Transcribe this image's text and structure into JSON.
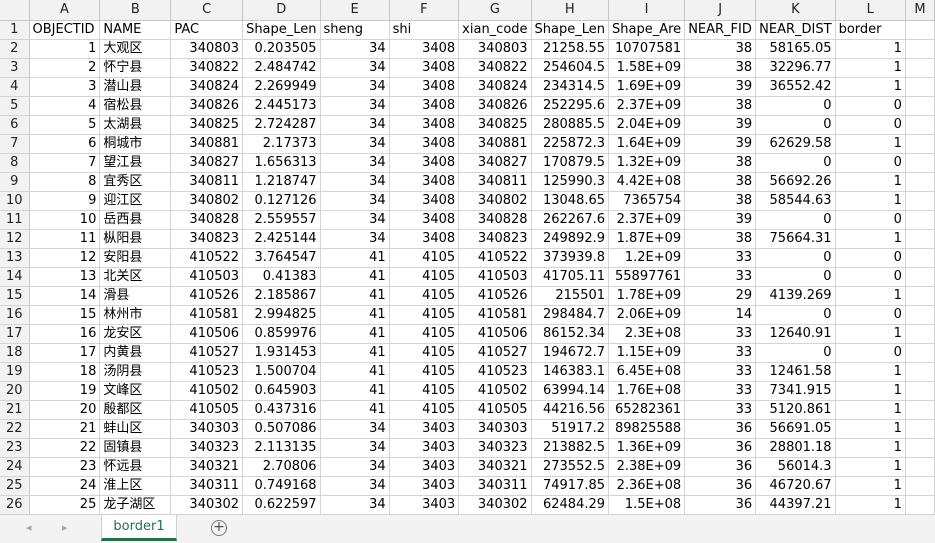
{
  "sheet": {
    "column_letters": [
      "A",
      "B",
      "C",
      "D",
      "E",
      "F",
      "G",
      "H",
      "I",
      "J",
      "K",
      "L",
      "M"
    ],
    "header_row": [
      "OBJECTID",
      "NAME",
      "PAC",
      "Shape_Len",
      "sheng",
      "shi",
      "xian_code",
      "Shape_Len",
      "Shape_Are",
      "NEAR_FID",
      "NEAR_DIST",
      "border",
      ""
    ],
    "rows": [
      [
        "1",
        "大观区",
        "340803",
        "0.203505",
        "34",
        "3408",
        "340803",
        "21258.55",
        "10707581",
        "38",
        "58165.05",
        "1",
        ""
      ],
      [
        "2",
        "怀宁县",
        "340822",
        "2.484742",
        "34",
        "3408",
        "340822",
        "254604.5",
        "1.58E+09",
        "38",
        "32296.77",
        "1",
        ""
      ],
      [
        "3",
        "潜山县",
        "340824",
        "2.269949",
        "34",
        "3408",
        "340824",
        "234314.5",
        "1.69E+09",
        "39",
        "36552.42",
        "1",
        ""
      ],
      [
        "4",
        "宿松县",
        "340826",
        "2.445173",
        "34",
        "3408",
        "340826",
        "252295.6",
        "2.37E+09",
        "38",
        "0",
        "0",
        ""
      ],
      [
        "5",
        "太湖县",
        "340825",
        "2.724287",
        "34",
        "3408",
        "340825",
        "280885.5",
        "2.04E+09",
        "39",
        "0",
        "0",
        ""
      ],
      [
        "6",
        "桐城市",
        "340881",
        "2.17373",
        "34",
        "3408",
        "340881",
        "225872.3",
        "1.64E+09",
        "39",
        "62629.58",
        "1",
        ""
      ],
      [
        "7",
        "望江县",
        "340827",
        "1.656313",
        "34",
        "3408",
        "340827",
        "170879.5",
        "1.32E+09",
        "38",
        "0",
        "0",
        ""
      ],
      [
        "8",
        "宜秀区",
        "340811",
        "1.218747",
        "34",
        "3408",
        "340811",
        "125990.3",
        "4.42E+08",
        "38",
        "56692.26",
        "1",
        ""
      ],
      [
        "9",
        "迎江区",
        "340802",
        "0.127126",
        "34",
        "3408",
        "340802",
        "13048.65",
        "7365754",
        "38",
        "58544.63",
        "1",
        ""
      ],
      [
        "10",
        "岳西县",
        "340828",
        "2.559557",
        "34",
        "3408",
        "340828",
        "262267.6",
        "2.37E+09",
        "39",
        "0",
        "0",
        ""
      ],
      [
        "11",
        "枞阳县",
        "340823",
        "2.425144",
        "34",
        "3408",
        "340823",
        "249892.9",
        "1.87E+09",
        "38",
        "75664.31",
        "1",
        ""
      ],
      [
        "12",
        "安阳县",
        "410522",
        "3.764547",
        "41",
        "4105",
        "410522",
        "373939.8",
        "1.2E+09",
        "33",
        "0",
        "0",
        ""
      ],
      [
        "13",
        "北关区",
        "410503",
        "0.41383",
        "41",
        "4105",
        "410503",
        "41705.11",
        "55897761",
        "33",
        "0",
        "0",
        ""
      ],
      [
        "14",
        "滑县",
        "410526",
        "2.185867",
        "41",
        "4105",
        "410526",
        "215501",
        "1.78E+09",
        "29",
        "4139.269",
        "1",
        ""
      ],
      [
        "15",
        "林州市",
        "410581",
        "2.994825",
        "41",
        "4105",
        "410581",
        "298484.7",
        "2.06E+09",
        "14",
        "0",
        "0",
        ""
      ],
      [
        "16",
        "龙安区",
        "410506",
        "0.859976",
        "41",
        "4105",
        "410506",
        "86152.34",
        "2.3E+08",
        "33",
        "12640.91",
        "1",
        ""
      ],
      [
        "17",
        "内黄县",
        "410527",
        "1.931453",
        "41",
        "4105",
        "410527",
        "194672.7",
        "1.15E+09",
        "33",
        "0",
        "0",
        ""
      ],
      [
        "18",
        "汤阴县",
        "410523",
        "1.500704",
        "41",
        "4105",
        "410523",
        "146383.1",
        "6.45E+08",
        "33",
        "12461.58",
        "1",
        ""
      ],
      [
        "19",
        "文峰区",
        "410502",
        "0.645903",
        "41",
        "4105",
        "410502",
        "63994.14",
        "1.76E+08",
        "33",
        "7341.915",
        "1",
        ""
      ],
      [
        "20",
        "殷都区",
        "410505",
        "0.437316",
        "41",
        "4105",
        "410505",
        "44216.56",
        "65282361",
        "33",
        "5120.861",
        "1",
        ""
      ],
      [
        "21",
        "蚌山区",
        "340303",
        "0.507086",
        "34",
        "3403",
        "340303",
        "51917.2",
        "89825588",
        "36",
        "56691.05",
        "1",
        ""
      ],
      [
        "22",
        "固镇县",
        "340323",
        "2.113135",
        "34",
        "3403",
        "340323",
        "213882.5",
        "1.36E+09",
        "36",
        "28801.18",
        "1",
        ""
      ],
      [
        "23",
        "怀远县",
        "340321",
        "2.70806",
        "34",
        "3403",
        "340321",
        "273552.5",
        "2.38E+09",
        "36",
        "56014.3",
        "1",
        ""
      ],
      [
        "24",
        "淮上区",
        "340311",
        "0.749168",
        "34",
        "3403",
        "340311",
        "74917.85",
        "2.36E+08",
        "36",
        "46720.67",
        "1",
        ""
      ],
      [
        "25",
        "龙子湖区",
        "340302",
        "0.622597",
        "34",
        "3403",
        "340302",
        "62484.29",
        "1.5E+08",
        "36",
        "44397.21",
        "1",
        ""
      ]
    ]
  },
  "tabs": {
    "active": "border1",
    "prev_icon": "◂",
    "next_icon": "▸",
    "add_icon": "+"
  }
}
